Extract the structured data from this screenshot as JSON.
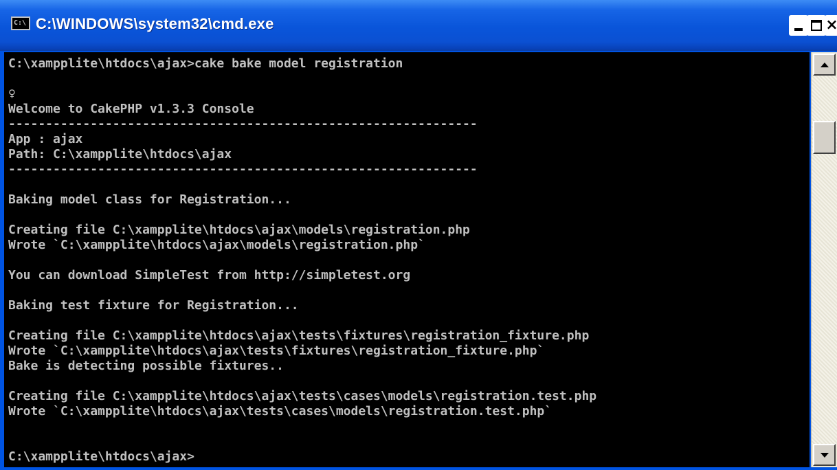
{
  "window": {
    "title": "C:\\WINDOWS\\system32\\cmd.exe",
    "icon": "cmd-icon",
    "icon_glyph": "C:\\",
    "buttons": {
      "minimize_icon": "minimize-icon",
      "maximize_icon": "maximize-icon",
      "close_icon": "close-icon",
      "close_glyph": "×"
    }
  },
  "console": {
    "lines": [
      "C:\\xampplite\\htdocs\\ajax>cake bake model registration",
      "",
      "♀",
      "Welcome to CakePHP v1.3.3 Console",
      "---------------------------------------------------------------",
      "App : ajax",
      "Path: C:\\xampplite\\htdocs\\ajax",
      "---------------------------------------------------------------",
      "",
      "Baking model class for Registration...",
      "",
      "Creating file C:\\xampplite\\htdocs\\ajax\\models\\registration.php",
      "Wrote `C:\\xampplite\\htdocs\\ajax\\models\\registration.php`",
      "",
      "You can download SimpleTest from http://simpletest.org",
      "",
      "Baking test fixture for Registration...",
      "",
      "Creating file C:\\xampplite\\htdocs\\ajax\\tests\\fixtures\\registration_fixture.php",
      "Wrote `C:\\xampplite\\htdocs\\ajax\\tests\\fixtures\\registration_fixture.php`",
      "Bake is detecting possible fixtures..",
      "",
      "Creating file C:\\xampplite\\htdocs\\ajax\\tests\\cases\\models\\registration.test.php",
      "Wrote `C:\\xampplite\\htdocs\\ajax\\tests\\cases\\models\\registration.test.php`",
      "",
      "",
      "C:\\xampplite\\htdocs\\ajax>"
    ]
  },
  "scrollbar": {
    "up_icon": "scroll-up-arrow-icon",
    "down_icon": "scroll-down-arrow-icon"
  },
  "colors": {
    "titlebar": "#0a55da",
    "console_bg": "#000000",
    "console_text": "#c0c0c0",
    "scrollbar_bg": "#ece9d8"
  }
}
